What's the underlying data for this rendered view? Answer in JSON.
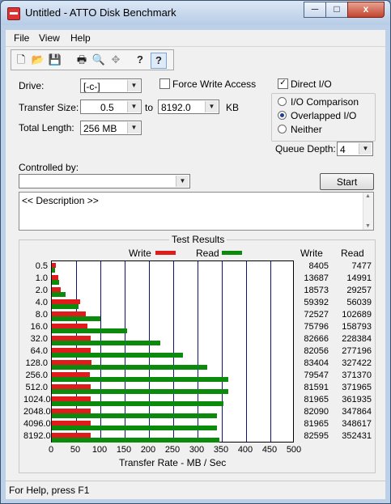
{
  "window": {
    "title": "Untitled - ATTO Disk Benchmark",
    "min_glyph": "─",
    "max_glyph": "□",
    "close_glyph": "x"
  },
  "menu": {
    "file": "File",
    "view": "View",
    "help": "Help"
  },
  "toolbar": {
    "new": "🗋",
    "open": "📂",
    "save": "💾",
    "print": "🖶",
    "preview": "🔍",
    "move": "✥",
    "help": "?",
    "context_help": "?"
  },
  "form": {
    "drive_label": "Drive:",
    "drive_value": "[-c-]",
    "force_write_label": "Force Write Access",
    "direct_io_label": "Direct I/O",
    "transfer_size_label": "Transfer Size:",
    "transfer_from": "0.5",
    "to_label": "to",
    "transfer_to": "8192.0",
    "kb_label": "KB",
    "total_length_label": "Total Length:",
    "total_length_value": "256 MB",
    "io_comparison_label": "I/O Comparison",
    "overlapped_io_label": "Overlapped I/O",
    "neither_label": "Neither",
    "queue_depth_label": "Queue Depth:",
    "queue_depth_value": "4",
    "controlled_by_label": "Controlled by:",
    "controlled_by_value": "",
    "start_label": "Start",
    "description_text": "<< Description >>"
  },
  "results": {
    "title": "Test Results",
    "write_legend": "Write",
    "read_legend": "Read",
    "write_col": "Write",
    "read_col": "Read",
    "xlabel": "Transfer Rate - MB / Sec"
  },
  "colors": {
    "write": "#e01b1b",
    "read": "#0c8a0c",
    "grid": "#11117a"
  },
  "chart_data": {
    "type": "bar",
    "orientation": "horizontal",
    "xlabel": "Transfer Rate - MB / Sec",
    "xlim": [
      0,
      500
    ],
    "xticks": [
      "0",
      "50",
      "100",
      "150",
      "200",
      "250",
      "300",
      "350",
      "400",
      "450",
      "500"
    ],
    "categories": [
      "0.5",
      "1.0",
      "2.0",
      "4.0",
      "8.0",
      "16.0",
      "32.0",
      "64.0",
      "128.0",
      "256.0",
      "512.0",
      "1024.0",
      "2048.0",
      "4096.0",
      "8192.0"
    ],
    "series": [
      {
        "name": "Write",
        "values": [
          8.2,
          13.4,
          18.2,
          58.0,
          70.8,
          74.0,
          80.7,
          80.1,
          81.4,
          77.7,
          79.7,
          80.0,
          80.2,
          80.0,
          80.7
        ],
        "labels": [
          "8405",
          "13687",
          "18573",
          "59392",
          "72527",
          "75796",
          "82666",
          "82056",
          "83404",
          "79547",
          "81591",
          "81965",
          "82090",
          "81965",
          "82595"
        ]
      },
      {
        "name": "Read",
        "values": [
          7.3,
          14.6,
          28.6,
          54.7,
          100.3,
          155.1,
          223.0,
          270.7,
          319.7,
          362.7,
          363.2,
          353.4,
          339.7,
          340.4,
          344.2
        ],
        "labels": [
          "7477",
          "14991",
          "29257",
          "56039",
          "102689",
          "158793",
          "228384",
          "277196",
          "327422",
          "371370",
          "371965",
          "361935",
          "347864",
          "348617",
          "352431"
        ]
      }
    ]
  },
  "statusbar": {
    "text": "For Help, press F1"
  }
}
